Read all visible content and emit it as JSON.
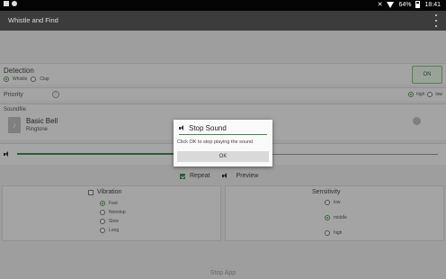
{
  "status_bar": {
    "battery": "64%",
    "time": "18:41"
  },
  "app_bar": {
    "title": "Whistle and Find"
  },
  "detection": {
    "label": "Detection",
    "options": [
      "Whistle",
      "Clap"
    ],
    "selected": "Whistle",
    "toggle_label": "ON"
  },
  "priority": {
    "label": "Priority",
    "options": [
      "high",
      "low"
    ],
    "selected": "high"
  },
  "soundfile": {
    "label": "Soundfile",
    "name": "Basic Bell",
    "type": "Ringtone"
  },
  "volume": {
    "level": 0.42
  },
  "playback": {
    "repeat_label": "Repeat",
    "repeat_checked": true,
    "preview_label": "Preview"
  },
  "vibration": {
    "label": "Vibration",
    "checked": false,
    "options": [
      "Fast",
      "Nonstop",
      "Slow",
      "Long"
    ],
    "selected": "Fast"
  },
  "sensitivity": {
    "label": "Sensitivity",
    "options": [
      "low",
      "middle",
      "high"
    ],
    "selected": "middle"
  },
  "footer": {
    "text": "Stop App"
  },
  "dialog": {
    "title": "Stop Sound",
    "message": "Click OK to stop playing the sound",
    "ok_label": "OK"
  },
  "colors": {
    "accent": "#3b8a52",
    "app_bar": "#3c3c3c",
    "status_bar": "#050505"
  }
}
